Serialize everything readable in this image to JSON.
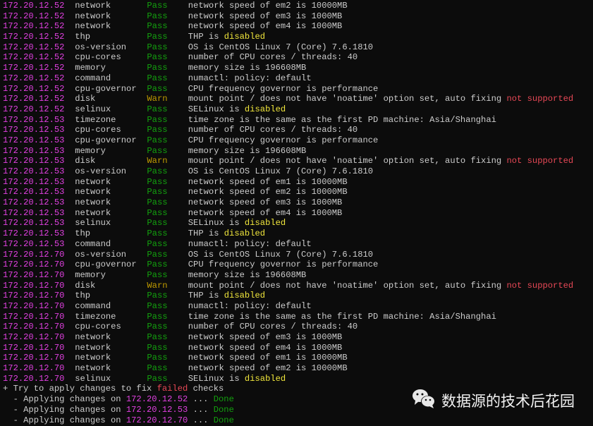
{
  "rows": [
    {
      "ip": "172.20.12.52",
      "check": "network",
      "status": "Pass",
      "msg": [
        {
          "t": "network speed of em2 is 10000MB"
        }
      ]
    },
    {
      "ip": "172.20.12.52",
      "check": "network",
      "status": "Pass",
      "msg": [
        {
          "t": "network speed of em3 is 1000MB"
        }
      ]
    },
    {
      "ip": "172.20.12.52",
      "check": "network",
      "status": "Pass",
      "msg": [
        {
          "t": "network speed of em4 is 1000MB"
        }
      ]
    },
    {
      "ip": "172.20.12.52",
      "check": "thp",
      "status": "Pass",
      "msg": [
        {
          "t": "THP is "
        },
        {
          "t": "disabled",
          "c": "yellow"
        }
      ]
    },
    {
      "ip": "172.20.12.52",
      "check": "os-version",
      "status": "Pass",
      "msg": [
        {
          "t": "OS is CentOS Linux 7 (Core) 7.6.1810"
        }
      ]
    },
    {
      "ip": "172.20.12.52",
      "check": "cpu-cores",
      "status": "Pass",
      "msg": [
        {
          "t": "number of CPU cores / threads: 40"
        }
      ]
    },
    {
      "ip": "172.20.12.52",
      "check": "memory",
      "status": "Pass",
      "msg": [
        {
          "t": "memory size is 196608MB"
        }
      ]
    },
    {
      "ip": "172.20.12.52",
      "check": "command",
      "status": "Pass",
      "msg": [
        {
          "t": "numactl: policy: default"
        }
      ]
    },
    {
      "ip": "172.20.12.52",
      "check": "cpu-governor",
      "status": "Pass",
      "msg": [
        {
          "t": "CPU frequency governor is performance"
        }
      ]
    },
    {
      "ip": "172.20.12.52",
      "check": "disk",
      "status": "Warn",
      "msg": [
        {
          "t": "mount point / does not have 'noatime' option set, auto fixing "
        },
        {
          "t": "not supported",
          "c": "red"
        }
      ]
    },
    {
      "ip": "172.20.12.52",
      "check": "selinux",
      "status": "Pass",
      "msg": [
        {
          "t": "SELinux is "
        },
        {
          "t": "disabled",
          "c": "yellow"
        }
      ]
    },
    {
      "ip": "172.20.12.53",
      "check": "timezone",
      "status": "Pass",
      "msg": [
        {
          "t": "time zone is the same as the first PD machine: Asia/Shanghai"
        }
      ]
    },
    {
      "ip": "172.20.12.53",
      "check": "cpu-cores",
      "status": "Pass",
      "msg": [
        {
          "t": "number of CPU cores / threads: 40"
        }
      ]
    },
    {
      "ip": "172.20.12.53",
      "check": "cpu-governor",
      "status": "Pass",
      "msg": [
        {
          "t": "CPU frequency governor is performance"
        }
      ]
    },
    {
      "ip": "172.20.12.53",
      "check": "memory",
      "status": "Pass",
      "msg": [
        {
          "t": "memory size is 196608MB"
        }
      ]
    },
    {
      "ip": "172.20.12.53",
      "check": "disk",
      "status": "Warn",
      "msg": [
        {
          "t": "mount point / does not have 'noatime' option set, auto fixing "
        },
        {
          "t": "not supported",
          "c": "red"
        }
      ]
    },
    {
      "ip": "172.20.12.53",
      "check": "os-version",
      "status": "Pass",
      "msg": [
        {
          "t": "OS is CentOS Linux 7 (Core) 7.6.1810"
        }
      ]
    },
    {
      "ip": "172.20.12.53",
      "check": "network",
      "status": "Pass",
      "msg": [
        {
          "t": "network speed of em1 is 10000MB"
        }
      ]
    },
    {
      "ip": "172.20.12.53",
      "check": "network",
      "status": "Pass",
      "msg": [
        {
          "t": "network speed of em2 is 10000MB"
        }
      ]
    },
    {
      "ip": "172.20.12.53",
      "check": "network",
      "status": "Pass",
      "msg": [
        {
          "t": "network speed of em3 is 1000MB"
        }
      ]
    },
    {
      "ip": "172.20.12.53",
      "check": "network",
      "status": "Pass",
      "msg": [
        {
          "t": "network speed of em4 is 1000MB"
        }
      ]
    },
    {
      "ip": "172.20.12.53",
      "check": "selinux",
      "status": "Pass",
      "msg": [
        {
          "t": "SELinux is "
        },
        {
          "t": "disabled",
          "c": "yellow"
        }
      ]
    },
    {
      "ip": "172.20.12.53",
      "check": "thp",
      "status": "Pass",
      "msg": [
        {
          "t": "THP is "
        },
        {
          "t": "disabled",
          "c": "yellow"
        }
      ]
    },
    {
      "ip": "172.20.12.53",
      "check": "command",
      "status": "Pass",
      "msg": [
        {
          "t": "numactl: policy: default"
        }
      ]
    },
    {
      "ip": "172.20.12.70",
      "check": "os-version",
      "status": "Pass",
      "msg": [
        {
          "t": "OS is CentOS Linux 7 (Core) 7.6.1810"
        }
      ]
    },
    {
      "ip": "172.20.12.70",
      "check": "cpu-governor",
      "status": "Pass",
      "msg": [
        {
          "t": "CPU frequency governor is performance"
        }
      ]
    },
    {
      "ip": "172.20.12.70",
      "check": "memory",
      "status": "Pass",
      "msg": [
        {
          "t": "memory size is 196608MB"
        }
      ]
    },
    {
      "ip": "172.20.12.70",
      "check": "disk",
      "status": "Warn",
      "msg": [
        {
          "t": "mount point / does not have 'noatime' option set, auto fixing "
        },
        {
          "t": "not supported",
          "c": "red"
        }
      ]
    },
    {
      "ip": "172.20.12.70",
      "check": "thp",
      "status": "Pass",
      "msg": [
        {
          "t": "THP is "
        },
        {
          "t": "disabled",
          "c": "yellow"
        }
      ]
    },
    {
      "ip": "172.20.12.70",
      "check": "command",
      "status": "Pass",
      "msg": [
        {
          "t": "numactl: policy: default"
        }
      ]
    },
    {
      "ip": "172.20.12.70",
      "check": "timezone",
      "status": "Pass",
      "msg": [
        {
          "t": "time zone is the same as the first PD machine: Asia/Shanghai"
        }
      ]
    },
    {
      "ip": "172.20.12.70",
      "check": "cpu-cores",
      "status": "Pass",
      "msg": [
        {
          "t": "number of CPU cores / threads: 40"
        }
      ]
    },
    {
      "ip": "172.20.12.70",
      "check": "network",
      "status": "Pass",
      "msg": [
        {
          "t": "network speed of em3 is 1000MB"
        }
      ]
    },
    {
      "ip": "172.20.12.70",
      "check": "network",
      "status": "Pass",
      "msg": [
        {
          "t": "network speed of em4 is 1000MB"
        }
      ]
    },
    {
      "ip": "172.20.12.70",
      "check": "network",
      "status": "Pass",
      "msg": [
        {
          "t": "network speed of em1 is 10000MB"
        }
      ]
    },
    {
      "ip": "172.20.12.70",
      "check": "network",
      "status": "Pass",
      "msg": [
        {
          "t": "network speed of em2 is 10000MB"
        }
      ]
    },
    {
      "ip": "172.20.12.70",
      "check": "selinux",
      "status": "Pass",
      "msg": [
        {
          "t": "SELinux is "
        },
        {
          "t": "disabled",
          "c": "yellow"
        }
      ]
    }
  ],
  "footer": [
    [
      {
        "t": "+ Try to apply changes to fix "
      },
      {
        "t": "failed",
        "c": "red"
      },
      {
        "t": " checks"
      }
    ],
    [
      {
        "t": "  - Applying changes on "
      },
      {
        "t": "172.20.12.52",
        "c": "mag"
      },
      {
        "t": " ... "
      },
      {
        "t": "Done",
        "c": "green"
      }
    ],
    [
      {
        "t": "  - Applying changes on "
      },
      {
        "t": "172.20.12.53",
        "c": "mag"
      },
      {
        "t": " ... "
      },
      {
        "t": "Done",
        "c": "green"
      }
    ],
    [
      {
        "t": "  - Applying changes on "
      },
      {
        "t": "172.20.12.70",
        "c": "mag"
      },
      {
        "t": " ... "
      },
      {
        "t": "Done",
        "c": "green"
      }
    ]
  ],
  "watermark": {
    "icon": "wechat-icon",
    "text": "数据源的技术后花园"
  }
}
